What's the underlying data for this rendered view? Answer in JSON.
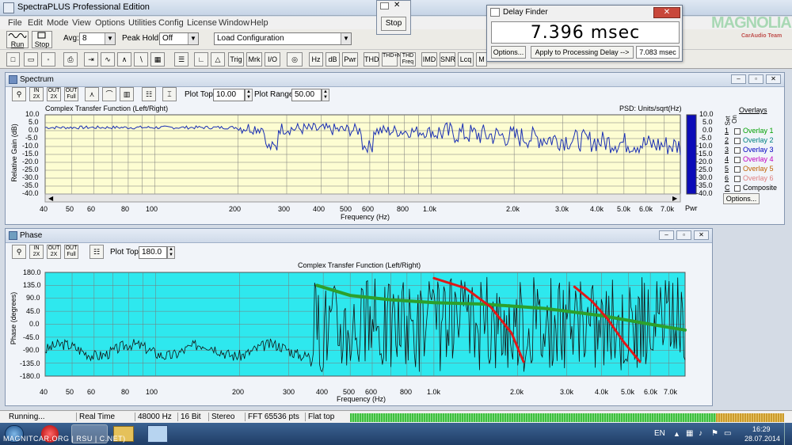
{
  "app": {
    "title": "SpectraPLUS Professional Edition"
  },
  "menu": [
    "File",
    "Edit",
    "Mode",
    "View",
    "Options",
    "Utilities",
    "Config",
    "License",
    "Window",
    "Help"
  ],
  "toolbar": {
    "run_label": "Run",
    "stop_label": "Stop",
    "avg_label": "Avg:",
    "avg_value": "8",
    "peak_hold_label": "Peak Hold:",
    "peak_hold_value": "Off",
    "config_value": "Load Configuration",
    "mode_buttons": [
      "Trig",
      "Mrk",
      "I/O",
      "Hz",
      "dB",
      "Pwr",
      "THD",
      "THD+N",
      "THD Freq",
      "IMD",
      "SNR",
      "Lcq",
      "M"
    ]
  },
  "stop_window": {
    "stop_label": "Stop"
  },
  "delay_finder": {
    "title": "Delay Finder",
    "value": "7.396 msec",
    "options_label": "Options...",
    "apply_label": "Apply to Processing Delay -->",
    "apply_value": "7.083 msec"
  },
  "logo": {
    "text": "MAGNOLIA",
    "sub": "CarAudio Team"
  },
  "spectrum": {
    "window_title": "Spectrum",
    "plot_top_label": "Plot Top:",
    "plot_top_value": "10.00",
    "plot_range_label": "Plot Range:",
    "plot_range_value": "50.00",
    "chart_title": "Complex Transfer Function (Left/Right)",
    "psd_label": "PSD: Units/sqrt(Hz)",
    "y_axis_label": "Relative Gain (dB)",
    "x_axis_label": "Frequency (Hz)",
    "y_ticks": [
      "10.0",
      "5.0",
      "0.0",
      "-5.0",
      "-10.0",
      "-15.0",
      "-20.0",
      "-25.0",
      "-30.0",
      "-35.0",
      "-40.0"
    ],
    "pwr_ticks": [
      "10.0",
      "5.0",
      "0.0",
      "-5.0",
      "-10.0",
      "-15.0",
      "-20.0",
      "-25.0",
      "-30.0",
      "-35.0",
      "-40.0"
    ],
    "pwr_label": "Pwr",
    "x_ticks": [
      "40",
      "50",
      "60",
      "80",
      "100",
      "200",
      "300",
      "400",
      "500",
      "600",
      "800",
      "1.0k",
      "2.0k",
      "3.0k",
      "4.0k",
      "5.0k",
      "6.0k",
      "7.0k"
    ],
    "overlays_title": "Overlays",
    "set_label": "Set",
    "on_label": "On",
    "overlays": [
      {
        "num": "1",
        "label": "Overlay 1",
        "color": "#00a000"
      },
      {
        "num": "2",
        "label": "Overlay 2",
        "color": "#008080"
      },
      {
        "num": "3",
        "label": "Overlay 3",
        "color": "#0000c0"
      },
      {
        "num": "4",
        "label": "Overlay 4",
        "color": "#c000c0"
      },
      {
        "num": "5",
        "label": "Overlay 5",
        "color": "#c06000"
      },
      {
        "num": "6",
        "label": "Overlay 6",
        "color": "#e08080"
      },
      {
        "num": "C",
        "label": "Composite",
        "color": "#000000"
      }
    ],
    "options_label": "Options..."
  },
  "phase": {
    "window_title": "Phase",
    "plot_top_label": "Plot Top:",
    "plot_top_value": "180.0",
    "chart_title": "Complex Transfer Function (Left/Right)",
    "y_axis_label": "Phase (degrees)",
    "x_axis_label": "Frequency (Hz)",
    "y_ticks": [
      "180.0",
      "135.0",
      "90.0",
      "45.0",
      "0.0",
      "-45.0",
      "-90.0",
      "-135.0",
      "-180.0"
    ],
    "x_ticks": [
      "40",
      "50",
      "60",
      "80",
      "100",
      "200",
      "300",
      "400",
      "500",
      "600",
      "800",
      "1.0k",
      "2.0k",
      "3.0k",
      "4.0k",
      "5.0k",
      "6.0k",
      "7.0k"
    ]
  },
  "status": {
    "items": [
      "Running...",
      "Real Time",
      "48000 Hz",
      "16 Bit",
      "Stereo",
      "FFT 65536 pts",
      "Flat top"
    ]
  },
  "taskbar": {
    "watermark": "MAGNITCAR.ORG | RSU | C.NET)",
    "lang": "EN",
    "time": "16:29",
    "date": "28.07.2014"
  },
  "colors": {
    "spectrum_bg": "#fdfdd2",
    "phase_bg": "#2ee8ee",
    "trace_blue": "#1a2fb4",
    "annotation_green": "#2ca02c",
    "annotation_red": "#e01818"
  }
}
